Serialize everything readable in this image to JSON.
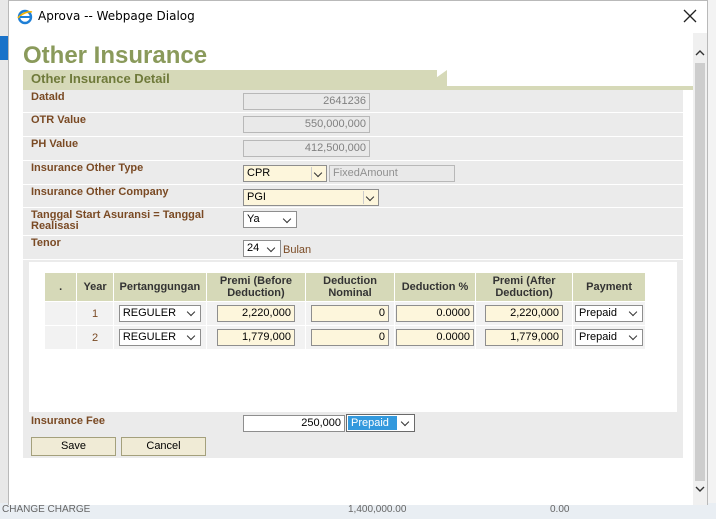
{
  "window": {
    "title": "Aprova -- Webpage Dialog"
  },
  "background": {
    "bottom_text_left": "CHANGE CHARGE",
    "bottom_text_mid": "1,400,000.00",
    "bottom_text_right": "0.00"
  },
  "page": {
    "title": "Other Insurance",
    "section_title": "Other Insurance Detail"
  },
  "form": {
    "data_id": {
      "label": "DataId",
      "value": "2641236"
    },
    "otr_value": {
      "label": "OTR Value",
      "value": "550,000,000"
    },
    "ph_value": {
      "label": "PH Value",
      "value": "412,500,000"
    },
    "insurance_other_type": {
      "label": "Insurance Other Type",
      "selected": "CPR",
      "fixed_amount_placeholder": "FixedAmount"
    },
    "insurance_other_company": {
      "label": "Insurance Other Company",
      "selected": "PGI"
    },
    "tanggal_start": {
      "label": "Tanggal Start Asuransi = Tanggal Realisasi",
      "selected": "Ya"
    },
    "tenor": {
      "label": "Tenor",
      "selected": "24",
      "unit": "Bulan"
    }
  },
  "table": {
    "headers": [
      ".",
      "Year",
      "Pertanggungan",
      "Premi (Before Deduction)",
      "Deduction Nominal",
      "Deduction %",
      "Premi (After Deduction)",
      "Payment"
    ],
    "rows": [
      {
        "year": "1",
        "pertanggungan": "REGULER",
        "premi_before": "2,220,000",
        "deduction_nominal": "0",
        "deduction_pct": "0.0000",
        "premi_after": "2,220,000",
        "payment": "Prepaid"
      },
      {
        "year": "2",
        "pertanggungan": "REGULER",
        "premi_before": "1,779,000",
        "deduction_nominal": "0",
        "deduction_pct": "0.0000",
        "premi_after": "1,779,000",
        "payment": "Prepaid"
      }
    ]
  },
  "fee": {
    "label": "Insurance Fee",
    "value": "250,000",
    "payment": "Prepaid"
  },
  "buttons": {
    "save": "Save",
    "cancel": "Cancel"
  },
  "colors": {
    "title": "#8a9a5b",
    "section_band": "#d6d9b8",
    "label": "#7a4a24",
    "input_yellow": "#fdf6dc",
    "selected_blue": "#3399dd"
  }
}
